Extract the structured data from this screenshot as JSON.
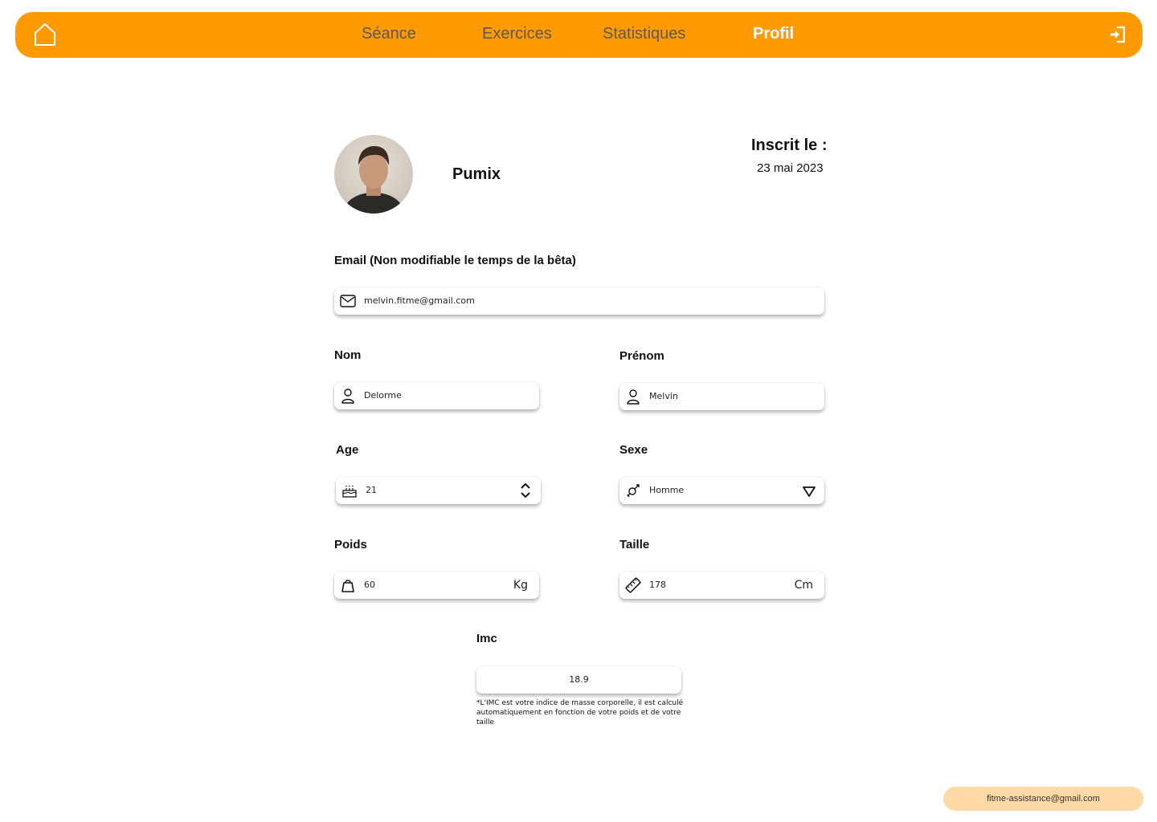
{
  "nav": {
    "links": [
      {
        "label": "Séance"
      },
      {
        "label": "Exercices"
      },
      {
        "label": "Statistiques"
      },
      {
        "label": "Profil"
      }
    ],
    "active": "Profil"
  },
  "profile": {
    "username": "Pumix",
    "registered_label": "Inscrit le :",
    "registered_date": "23 mai 2023"
  },
  "form": {
    "email": {
      "label": "Email (Non modifiable le temps de la bêta)",
      "value": "melvin.fitme@gmail.com",
      "icon": "mail-icon"
    },
    "nom": {
      "label": "Nom",
      "value": "Delorme",
      "icon": "user-icon"
    },
    "prenom": {
      "label": "Prénom",
      "value": "Melvin",
      "icon": "user-icon"
    },
    "age": {
      "label": "Age",
      "value": "21",
      "icon": "cake-icon"
    },
    "sexe": {
      "label": "Sexe",
      "value": "Homme",
      "icon": "gender-icon"
    },
    "poids": {
      "label": "Poids",
      "value": "60",
      "unit": "Kg",
      "icon": "weight-icon"
    },
    "taille": {
      "label": "Taille",
      "value": "178",
      "unit": "Cm",
      "icon": "ruler-icon"
    },
    "imc": {
      "label": "Imc",
      "value": "18.9"
    },
    "imc_note": "*L'IMC est votre indice de masse corporelle, il est calculé automatiquement en fonction de votre poids et de votre taille"
  },
  "footer": {
    "assistance_email": "fitme-assistance@gmail.com"
  },
  "colors": {
    "accent": "#ff9a00",
    "assist_bg": "#ffd9a6"
  }
}
